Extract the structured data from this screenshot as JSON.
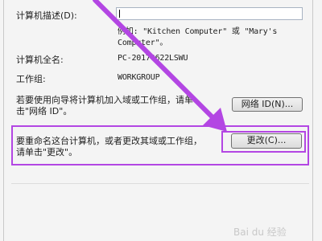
{
  "form": {
    "desc_label": "计算机描述(D):",
    "desc_value": "",
    "example_line1": "例如: \"Kitchen Computer\" 或 \"Mary's",
    "example_line2": "Computer\"。",
    "fullname_label": "计算机全名:",
    "fullname_value": "PC-20170622LSWU",
    "workgroup_label": "工作组:",
    "workgroup_value": "WORKGROUP"
  },
  "network": {
    "text_line1": "若要使用向导将计算机加入域或工作组，请单",
    "text_line2": "击\"网络 ID\"。",
    "button_label": "网络 ID(N)..."
  },
  "rename": {
    "text_line1": "要重命名这台计算机，或者更改其域或工作组，",
    "text_line2": "请单击\"更改\"。",
    "button_label": "更改(C)..."
  },
  "annotation": {
    "color": "#b346e3"
  },
  "watermark": "Bai du 经验"
}
